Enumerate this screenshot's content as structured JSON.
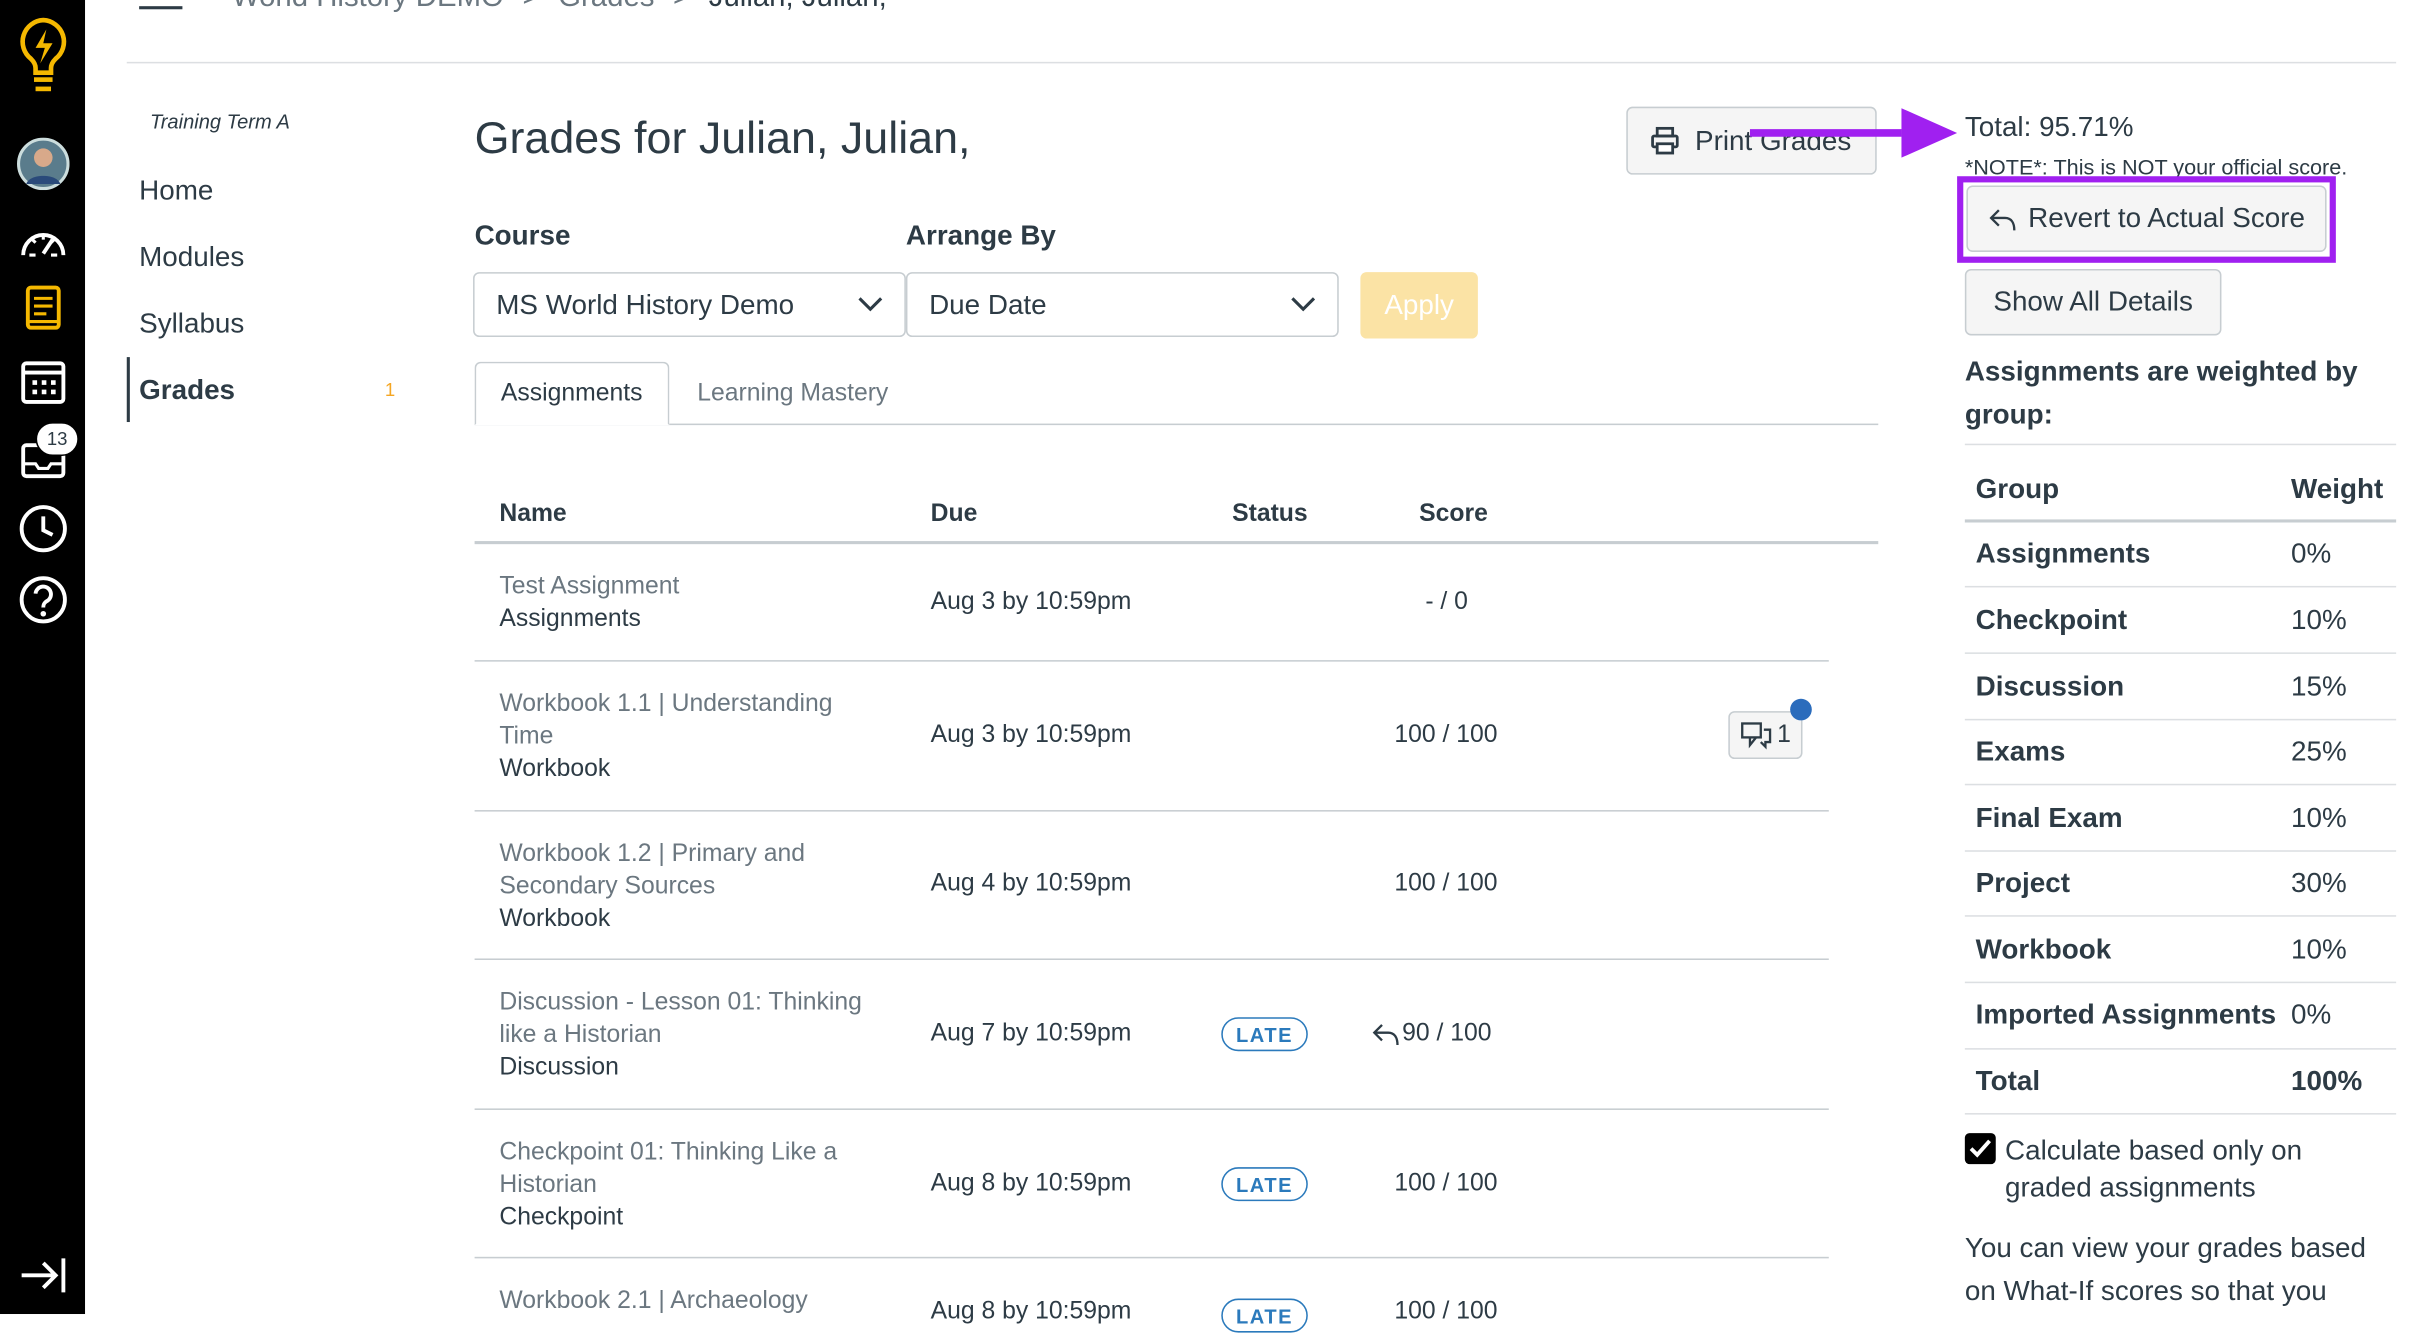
{
  "global_nav": {
    "inbox_badge": "13",
    "items": [
      "logo-icon",
      "account-avatar",
      "dashboard-icon",
      "courses-icon",
      "calendar-icon",
      "inbox-icon",
      "history-icon",
      "help-icon"
    ]
  },
  "breadcrumb": {
    "course": "World History DEMO",
    "sep": ">",
    "section": "Grades",
    "student": "Julian, Julian,"
  },
  "course_nav": {
    "term": "Training Term A",
    "items": [
      {
        "label": "Home"
      },
      {
        "label": "Modules"
      },
      {
        "label": "Syllabus"
      },
      {
        "label": "Grades",
        "count": "1"
      }
    ]
  },
  "main": {
    "title": "Grades for Julian, Julian,",
    "print_label": "Print Grades",
    "course_label": "Course",
    "course_value": "MS World History Demo",
    "arrange_label": "Arrange By",
    "arrange_value": "Due Date",
    "apply_label": "Apply",
    "tabs": [
      {
        "label": "Assignments",
        "active": true
      },
      {
        "label": "Learning Mastery",
        "active": false
      }
    ],
    "columns": [
      "Name",
      "Due",
      "Status",
      "Score"
    ],
    "rows": [
      {
        "name": "Test Assignment",
        "group": "Assignments",
        "due": "Aug 3 by 10:59pm",
        "status": "",
        "score": "- / 0"
      },
      {
        "name": "Workbook 1.1 | Understanding Time",
        "group": "Workbook",
        "due": "Aug 3 by 10:59pm",
        "status": "",
        "score": "100 / 100",
        "comments": "1"
      },
      {
        "name": "Workbook 1.2 | Primary and Secondary Sources",
        "group": "Workbook",
        "due": "Aug 4 by 10:59pm",
        "status": "",
        "score": "100 / 100"
      },
      {
        "name": "Discussion - Lesson 01: Thinking like a Historian",
        "group": "Discussion",
        "due": "Aug 7 by 10:59pm",
        "status": "LATE",
        "score": "90 / 100"
      },
      {
        "name": "Checkpoint 01: Thinking Like a Historian",
        "group": "Checkpoint",
        "due": "Aug 8 by 10:59pm",
        "status": "LATE",
        "score": "100 / 100"
      },
      {
        "name": "Workbook 2.1 | Archaeology",
        "group": "",
        "due": "Aug 8 by 10:59pm",
        "status": "LATE",
        "score": "100 / 100"
      }
    ]
  },
  "sidebar": {
    "total": "Total: 95.71%",
    "note": "*NOTE*: This is NOT your official score.",
    "revert_label": "Revert to Actual Score",
    "show_details_label": "Show All Details",
    "weighted_heading": "Assignments are weighted by group:",
    "weights_header": {
      "group": "Group",
      "weight": "Weight"
    },
    "weights": [
      {
        "group": "Assignments",
        "weight": "0%"
      },
      {
        "group": "Checkpoint",
        "weight": "10%"
      },
      {
        "group": "Discussion",
        "weight": "15%"
      },
      {
        "group": "Exams",
        "weight": "25%"
      },
      {
        "group": "Final Exam",
        "weight": "10%"
      },
      {
        "group": "Project",
        "weight": "30%"
      },
      {
        "group": "Workbook",
        "weight": "10%"
      },
      {
        "group": "Imported Assignments",
        "weight": "0%"
      },
      {
        "group": "Total",
        "weight": "100%"
      }
    ],
    "calc_label": "Calculate based only on graded assignments",
    "calc_checked": true,
    "whatif_text": "You can view your grades based on What-If scores so that you"
  },
  "annotation": {
    "color": "#a020f0"
  }
}
